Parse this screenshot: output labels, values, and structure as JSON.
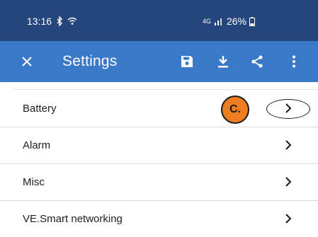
{
  "status_bar": {
    "time": "13:16",
    "network": "4G",
    "battery": "26%"
  },
  "app_bar": {
    "title": "Settings",
    "icons": [
      "close-icon",
      "save-icon",
      "download-icon",
      "share-icon",
      "more-vert-icon"
    ]
  },
  "settings": {
    "items": [
      {
        "label": "Battery"
      },
      {
        "label": "Alarm"
      },
      {
        "label": "Misc"
      },
      {
        "label": "VE.Smart networking"
      }
    ]
  },
  "annotation": {
    "badge_label": "C.",
    "badge_color": "#ee7d22"
  },
  "colors": {
    "status_bar": "#25467c",
    "app_bar": "#3a78c8"
  }
}
